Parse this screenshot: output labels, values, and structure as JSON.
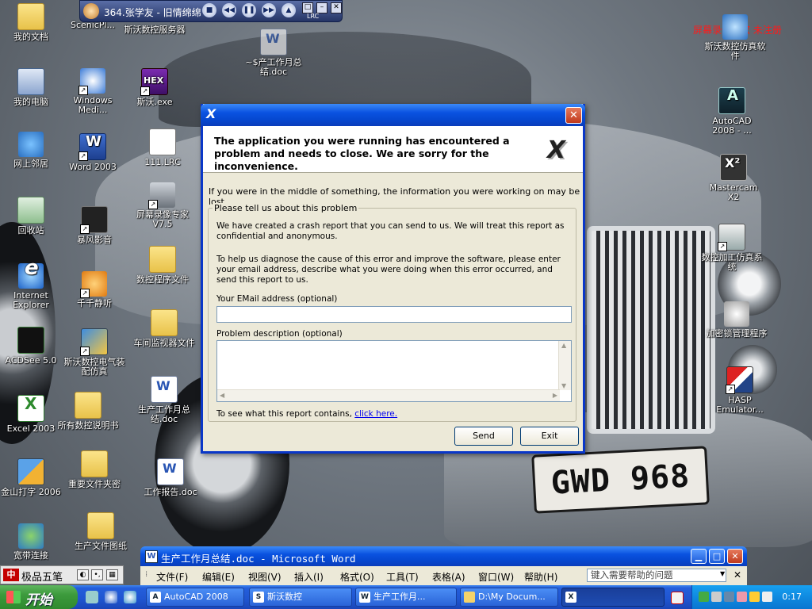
{
  "desktop": {
    "icons_left": [
      {
        "label": "我的文档",
        "icon": "my-documents-icon"
      },
      {
        "label": "我的电脑",
        "icon": "my-computer-icon"
      },
      {
        "label": "网上邻居",
        "icon": "network-places-icon"
      },
      {
        "label": "回收站",
        "icon": "recycle-bin-icon"
      },
      {
        "label": "Internet Explorer",
        "icon": "internet-explorer-icon"
      },
      {
        "label": "ACDSee 5.0",
        "icon": "acdsee-icon"
      },
      {
        "label": "Excel 2003",
        "icon": "excel-icon"
      },
      {
        "label": "金山打字 2006",
        "icon": "typing-tutor-icon"
      },
      {
        "label": "宽带连接",
        "icon": "broadband-connection-icon"
      }
    ],
    "icons_col2": [
      {
        "label": "ScenicPl...",
        "icon": "scenic-player-icon"
      },
      {
        "label": "Windows Medi...",
        "icon": "windows-media-icon"
      },
      {
        "label": "Word 2003",
        "icon": "word-icon"
      },
      {
        "label": "暴风影音",
        "icon": "storm-player-icon"
      },
      {
        "label": "千千静听",
        "icon": "ttplayer-icon"
      },
      {
        "label": "斯沃数控电气装配仿真",
        "icon": "electrical-sim-icon"
      },
      {
        "label": "所有数控说明书",
        "icon": "folder-icon"
      },
      {
        "label": "重要文件夹密",
        "icon": "folder-icon"
      },
      {
        "label": "生产文件图纸",
        "icon": "folder-icon"
      }
    ],
    "icons_col3": [
      {
        "label": "斯沃数控服务器",
        "icon": "server-icon"
      },
      {
        "label": "斯沃.exe",
        "icon": "hex-exe-icon"
      },
      {
        "label": "111.LRC",
        "icon": "text-file-icon"
      },
      {
        "label": "屏幕录像专家V7.5",
        "icon": "screen-recorder-icon"
      },
      {
        "label": "数控程序文件",
        "icon": "folder-icon"
      },
      {
        "label": "车间监视器文件",
        "icon": "folder-icon"
      },
      {
        "label": "生产工作月总结.doc",
        "icon": "word-doc-icon"
      },
      {
        "label": "工作报告.doc",
        "icon": "word-doc-icon"
      }
    ],
    "icon_top_doc": {
      "label": "~$产工作月总结.doc",
      "icon": "word-doc-icon"
    },
    "icons_right": [
      {
        "label": "斯沃数控仿真软件",
        "icon": "globe-icon"
      },
      {
        "label": "AutoCAD 2008 - ...",
        "icon": "autocad-icon"
      },
      {
        "label": "Mastercam X2",
        "icon": "mastercam-icon"
      },
      {
        "label": "数控加工仿真系统",
        "icon": "cnc-sim-icon"
      },
      {
        "label": "加密锁管理程序",
        "icon": "phone-icon"
      },
      {
        "label": "HASP Emulator...",
        "icon": "hasp-icon"
      }
    ],
    "wallpaper_plate": "GWD 968",
    "watermark": "屏幕录像专家 未注册"
  },
  "player": {
    "track": "364.张学友 - 旧情绵绵",
    "buttons": [
      "stop",
      "prev",
      "pause",
      "next",
      "eject"
    ],
    "lrc": "LRC"
  },
  "dialog": {
    "title_icon": "X",
    "close": "✕",
    "header": "The application you were running has encountered a problem and needs to close.  We are sorry for the inconvenience.",
    "logo": "X",
    "info": "If you were in the middle of something, the information you were working on may be lost.",
    "group_title": "Please tell us about this problem",
    "report_text": "We have created a crash report that you can send to us.  We will treat this report as confidential and anonymous.",
    "help_text": "To help us diagnose the cause of this error and improve the software, please enter your email address, describe what you were doing when this error occurred, and send this report to us.",
    "email_label": "Your EMail address (optional)",
    "email_value": "",
    "desc_label": "Problem description (optional)",
    "desc_value": "",
    "see_text": "To see what this report contains,",
    "see_link": "click here.",
    "send": "Send",
    "exit": "Exit"
  },
  "word": {
    "title": "生产工作月总结.doc - Microsoft Word",
    "menus": [
      "文件(F)",
      "编辑(E)",
      "视图(V)",
      "插入(I)",
      "格式(O)",
      "工具(T)",
      "表格(A)",
      "窗口(W)",
      "帮助(H)"
    ],
    "help_placeholder": "键入需要帮助的问题"
  },
  "ime": {
    "logo": "中",
    "name": "极品五笔"
  },
  "taskbar": {
    "start": "开始",
    "tasks": [
      {
        "label": "AutoCAD 2008",
        "icon": "autocad-task-icon"
      },
      {
        "label": "斯沃数控",
        "icon": "sim-task-icon"
      },
      {
        "label": "生产工作月...",
        "icon": "word-task-icon"
      },
      {
        "label": "D:\\My Docum...",
        "icon": "folder-task-icon"
      },
      {
        "label": "",
        "icon": "crash-app-task-icon"
      }
    ],
    "clock": "0:17"
  },
  "colors": {
    "xp_blue": "#0a52e0",
    "close_red": "#c0391c",
    "dialog_bg": "#ece9d8",
    "watermark": "#ff1a1a"
  }
}
